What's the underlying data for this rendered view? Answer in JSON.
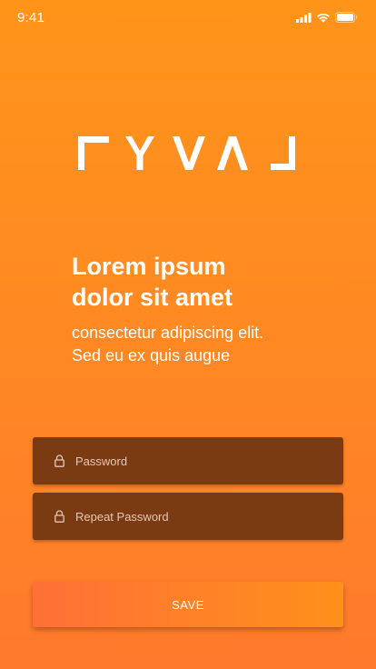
{
  "status_bar": {
    "time": "9:41",
    "icons": [
      "signal-icon",
      "wifi-icon",
      "battery-icon"
    ]
  },
  "logo": {
    "text": "RYVAL",
    "color": "#ffffff"
  },
  "hero": {
    "headline_line1": "Lorem ipsum",
    "headline_line2": "dolor sit amet",
    "subtext_line1": "consectetur adipiscing elit.",
    "subtext_line2": "Sed eu ex quis augue"
  },
  "form": {
    "password": {
      "placeholder": "Password",
      "value": "",
      "icon": "lock-icon"
    },
    "repeat_password": {
      "placeholder": "Repeat Password",
      "value": "",
      "icon": "lock-icon"
    },
    "save_label": "SAVE"
  },
  "colors": {
    "background_top": "#ff9419",
    "background_bottom": "#ff7a2c",
    "field_background": "#7a3a12",
    "button_left": "#ff6f36",
    "button_right": "#ff901a",
    "text": "#ffffff"
  }
}
